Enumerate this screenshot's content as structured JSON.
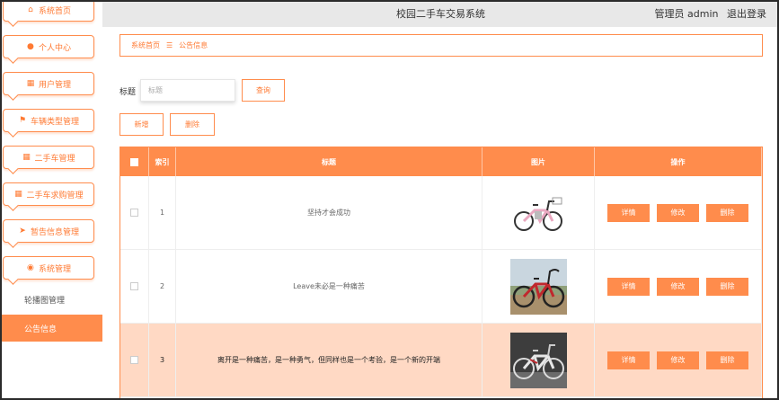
{
  "header": {
    "title": "校园二手车交易系统",
    "user_label": "管理员 admin",
    "logout": "退出登录"
  },
  "sidebar": {
    "items": [
      {
        "label": "系统首页",
        "icon": "home-icon"
      },
      {
        "label": "个人中心",
        "icon": "person-icon"
      },
      {
        "label": "用户管理",
        "icon": "grid-icon"
      },
      {
        "label": "车辆类型管理",
        "icon": "flag-icon"
      },
      {
        "label": "二手车管理",
        "icon": "grid-icon"
      },
      {
        "label": "二手车求购管理",
        "icon": "grid-icon"
      },
      {
        "label": "暂告信息管理",
        "icon": "send-icon"
      },
      {
        "label": "系统管理",
        "icon": "location-icon"
      }
    ],
    "sub_items": [
      {
        "label": "轮播图管理",
        "active": false
      },
      {
        "label": "公告信息",
        "active": true
      }
    ]
  },
  "breadcrumb": {
    "home": "系统首页",
    "separator": "☰",
    "current": "公告信息"
  },
  "search": {
    "label": "标题",
    "placeholder": "标题",
    "button": "查询"
  },
  "actions": {
    "add": "新增",
    "delete": "删除"
  },
  "table": {
    "headers": {
      "index": "索引",
      "title": "标题",
      "image": "图片",
      "ops": "操作"
    },
    "row_actions": {
      "detail": "详情",
      "edit": "修改",
      "delete": "删除"
    },
    "rows": [
      {
        "index": "1",
        "title": "坚持才会成功",
        "image": "e-bike-image"
      },
      {
        "index": "2",
        "title": "Leave未必是一种痛苦",
        "image": "red-cruiser-bike-image"
      },
      {
        "index": "3",
        "title": "离开是一种痛苦，是一种勇气，但同样也是一个考验，是一个新的开端",
        "image": "grey-bike-image"
      }
    ]
  },
  "colors": {
    "accent": "#ff8c4c",
    "highlight_row": "#ffd9c4",
    "header_bg": "#e8e8e8"
  }
}
